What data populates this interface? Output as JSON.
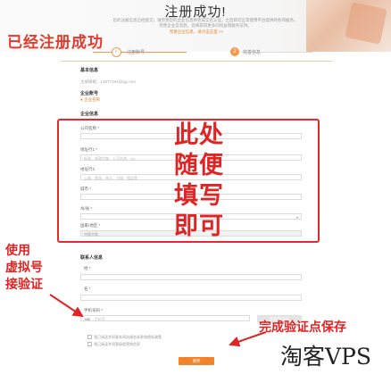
{
  "banner": {
    "title": "注册成功!",
    "desc_line1": "您的注册信息已经提交，请完善您的企业信息并完成实名认证，之后即可正常使用平台提供的各项服务。",
    "desc_line2": "完善企业信息后，您将获得更多的权益和服务支持。",
    "link": "完善企业信息，请点击这里 >>"
  },
  "annotations": {
    "success": "已经注册成功",
    "fill_here": [
      "此处",
      "随便",
      "填写",
      "即可"
    ],
    "use_virtual": [
      "使用",
      "虚拟号",
      "接验证"
    ],
    "save_note": "完成验证点保存"
  },
  "steps": [
    {
      "label": "注册账号",
      "mark": "✓"
    },
    {
      "label": "完善信息",
      "mark": "2"
    }
  ],
  "form": {
    "basic_title": "基本信息",
    "account_line": "注册邮箱：14877164@qq.com",
    "company_title": "企业账号",
    "company_value": "● 企业名称",
    "company_info_title": "企业信息",
    "fields": [
      {
        "label": "公司名称 *",
        "placeholder": ""
      },
      {
        "label": "地址行1 *",
        "placeholder": "街道、邮政信箱、公司名称、c/o"
      },
      {
        "label": "地址行2",
        "placeholder": "公寓、套间、单元、大楼、楼层等"
      },
      {
        "label": "城市 *",
        "placeholder": ""
      },
      {
        "label": "州/省 *",
        "placeholder": ""
      },
      {
        "label": "国家/地区 *",
        "placeholder": "中国大陆"
      }
    ],
    "contact_title": "联系人信息",
    "contact_fields": [
      {
        "label": "姓 *",
        "placeholder": ""
      },
      {
        "label": "名 *",
        "placeholder": ""
      }
    ],
    "phone_label": "手机号码 *",
    "phone_prefix": "+86",
    "phone_placeholder": "手机号",
    "code_button": "获取验证码",
    "checkbox1": "我已阅读并同意本网站服务条款和隐私政策",
    "checkbox2": "我已阅读并同意接收营销信息",
    "submit": "保存"
  },
  "watermark": "淘客VPS",
  "colors": {
    "accent": "#f0832a",
    "annotation": "#e02424"
  }
}
